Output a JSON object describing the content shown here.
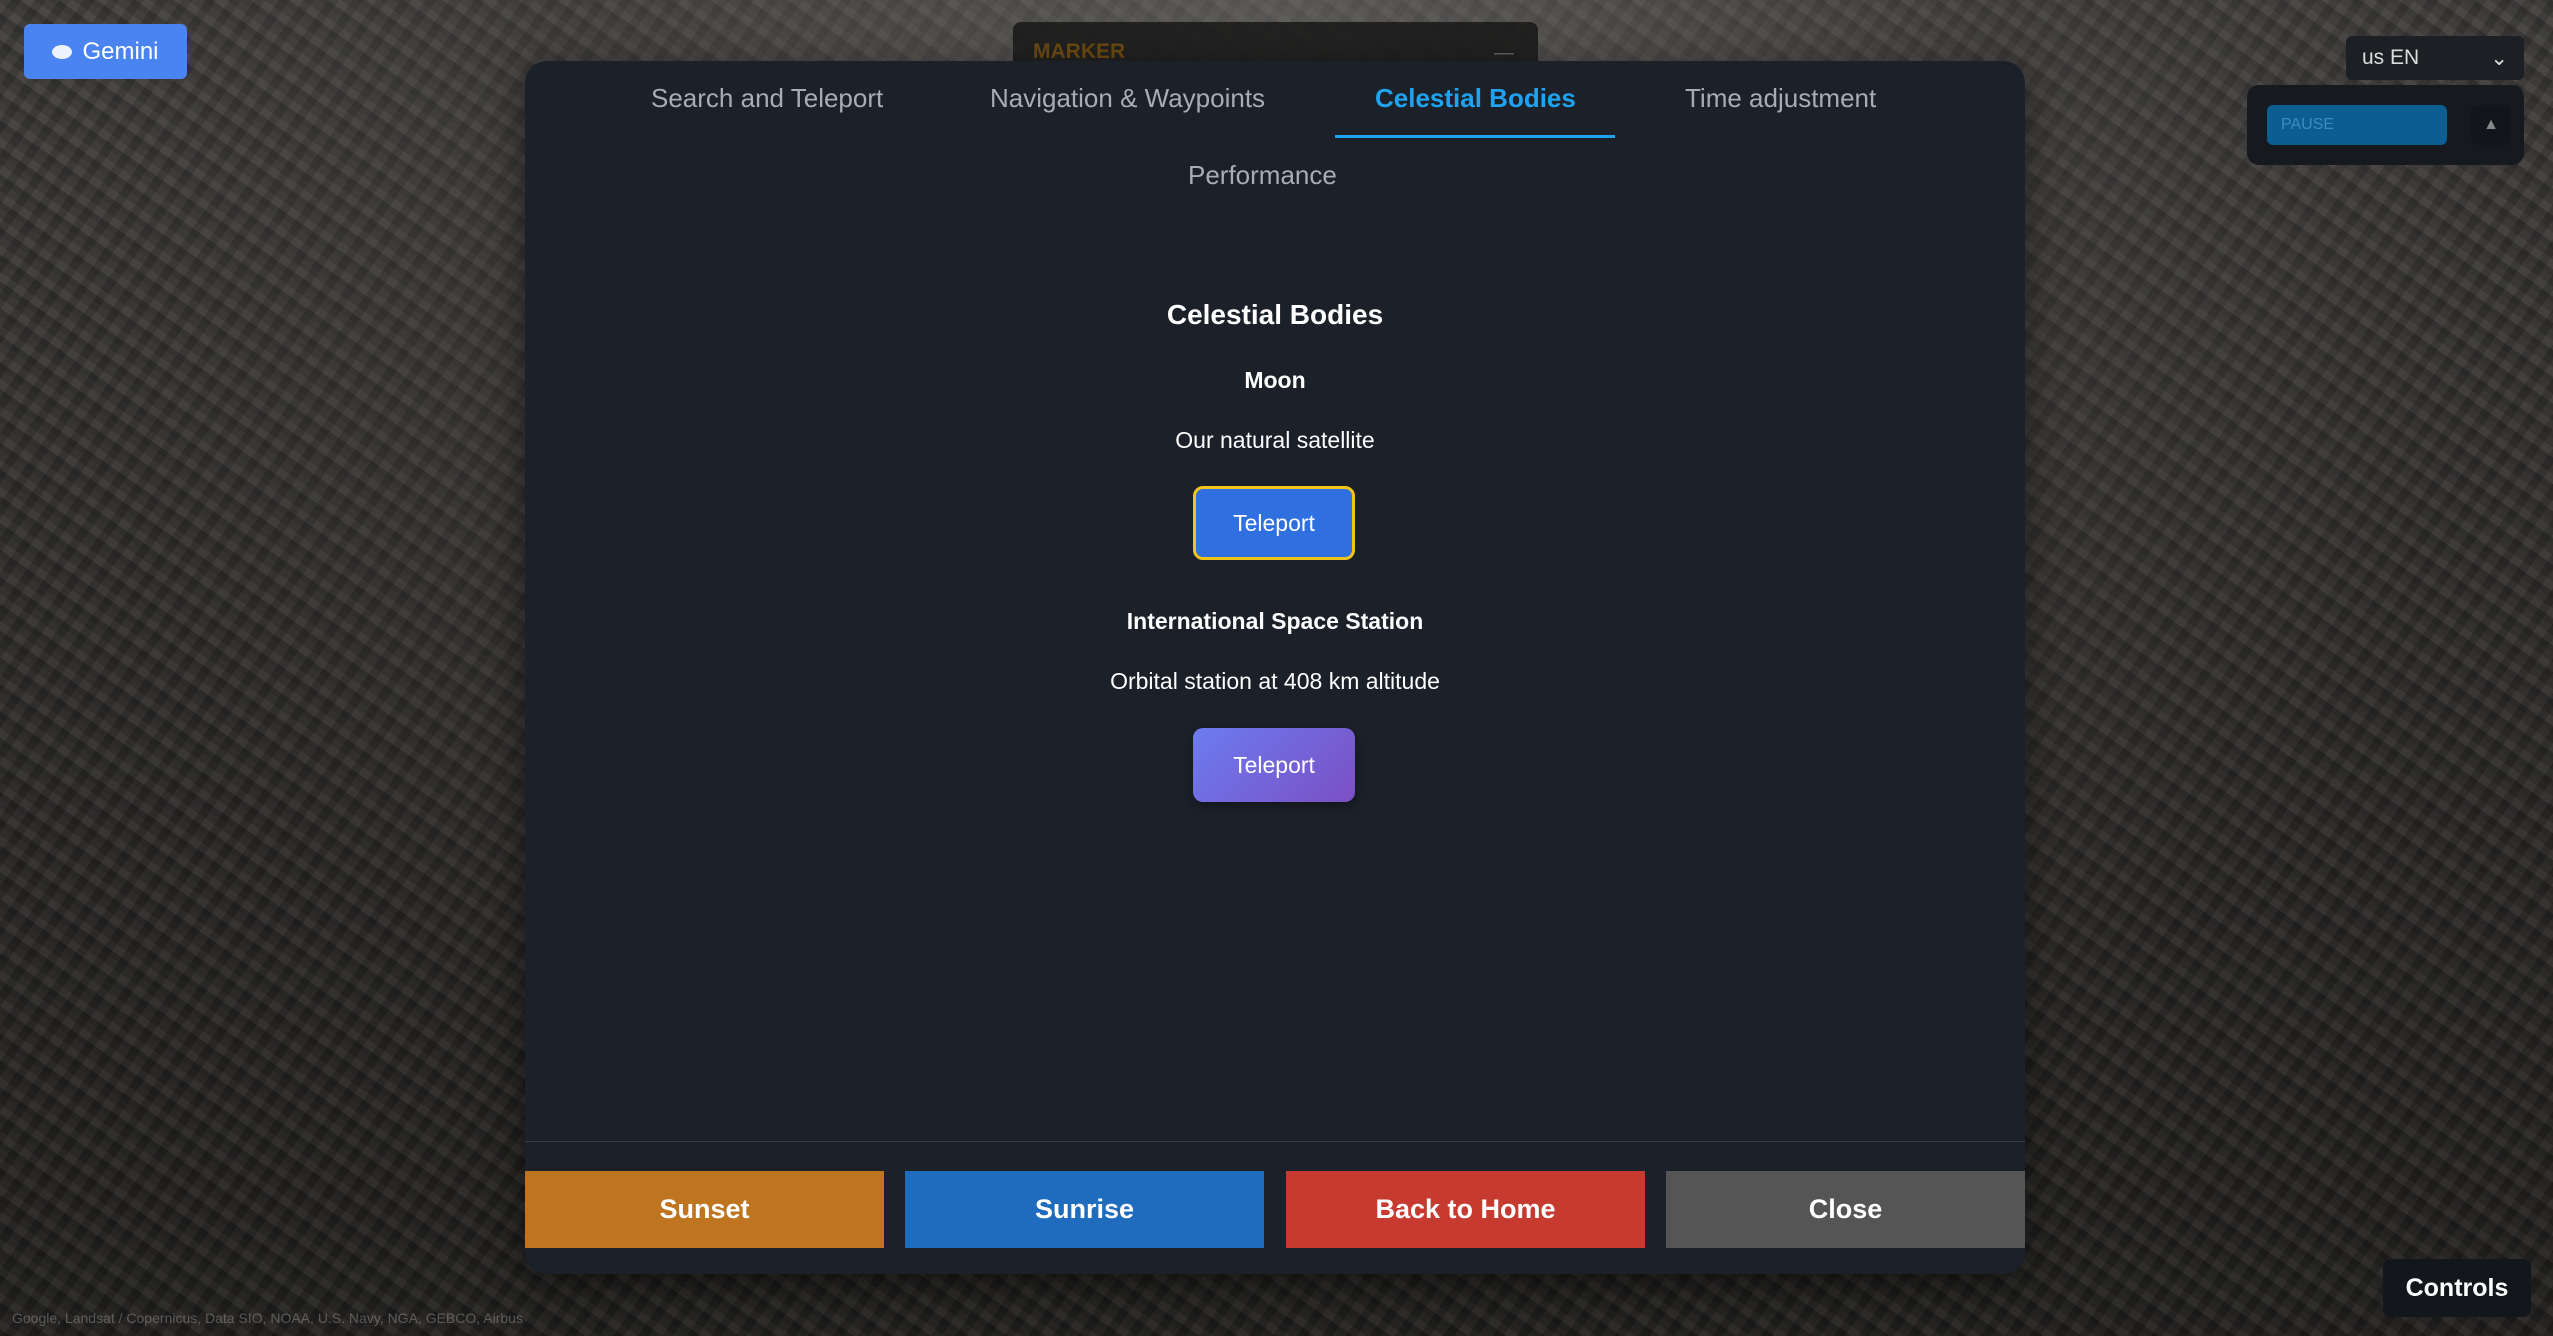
{
  "gemini": {
    "label": "Gemini",
    "icon": "chat-bubble-icon"
  },
  "marker": {
    "label": "MARKER",
    "minimize": "—"
  },
  "language": {
    "value": "us EN"
  },
  "pause_panel": {
    "pause_label": "PAUSE",
    "sound_icon": "speaker-icon"
  },
  "tabs": [
    {
      "label": "Search and Teleport",
      "active": false
    },
    {
      "label": "Navigation & Waypoints",
      "active": false
    },
    {
      "label": "Celestial Bodies",
      "active": true
    },
    {
      "label": "Time adjustment",
      "active": false
    },
    {
      "label": "Performance",
      "active": false
    }
  ],
  "section": {
    "title": "Celestial Bodies",
    "bodies": [
      {
        "name": "Moon",
        "description": "Our natural satellite",
        "button": "Teleport"
      },
      {
        "name": "International Space Station",
        "description": "Orbital station at 408 km altitude",
        "button": "Teleport"
      }
    ]
  },
  "actions": [
    {
      "label": "Sunset",
      "color": "#bf7420"
    },
    {
      "label": "Sunrise",
      "color": "#1f6cbf"
    },
    {
      "label": "Back to Home",
      "color": "#c63a30"
    },
    {
      "label": "Close",
      "color": "#555555"
    }
  ],
  "controls": {
    "label": "Controls"
  },
  "attribution": "Google, Landsat / Copernicus, Data SIO, NOAA, U.S. Navy, NGA, GEBCO, Airbus"
}
